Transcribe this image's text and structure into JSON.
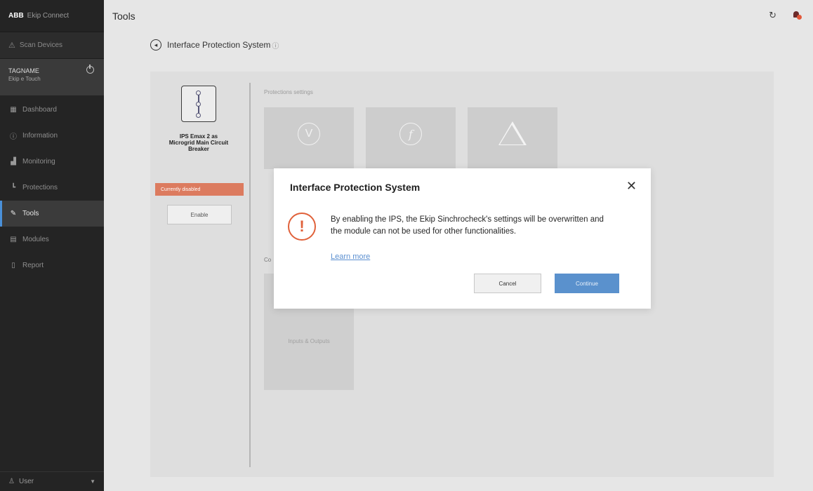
{
  "app": {
    "brand_logo": "ABB",
    "brand_name": "Ekip Connect"
  },
  "sidebar": {
    "scan_label": "Scan Devices",
    "device": {
      "tagname": "TAGNAME",
      "subtitle": "Ekip e Touch"
    },
    "items": [
      {
        "label": "Dashboard",
        "icon": "dashboard-icon"
      },
      {
        "label": "Information",
        "icon": "info-icon"
      },
      {
        "label": "Monitoring",
        "icon": "chart-icon"
      },
      {
        "label": "Protections",
        "icon": "protections-icon"
      },
      {
        "label": "Tools",
        "icon": "wrench-icon",
        "active": true
      },
      {
        "label": "Modules",
        "icon": "modules-icon"
      },
      {
        "label": "Report",
        "icon": "report-icon"
      }
    ],
    "user_label": "User"
  },
  "header": {
    "title": "Tools"
  },
  "breadcrumb": {
    "label": "Interface Protection System"
  },
  "ips_panel": {
    "name": "IPS Emax 2 as Microgrid Main Circuit Breaker",
    "status_badge": "Currently disabled",
    "enable_label": "Enable"
  },
  "protections": {
    "section_title": "Protections settings",
    "truncated_section": "Co",
    "inputs_outputs_label": "Inputs & Outputs"
  },
  "modal": {
    "title": "Interface Protection System",
    "message": "By enabling the IPS, the Ekip Sinchrocheck's settings will be overwritten and the module can not be used for other functionalities.",
    "learn_more": "Learn more",
    "cancel_label": "Cancel",
    "continue_label": "Continue"
  },
  "colors": {
    "accent": "#5a91cd",
    "warning": "#e0613a",
    "sidebar_bg": "#242424",
    "badge": "#dc7b5f"
  }
}
